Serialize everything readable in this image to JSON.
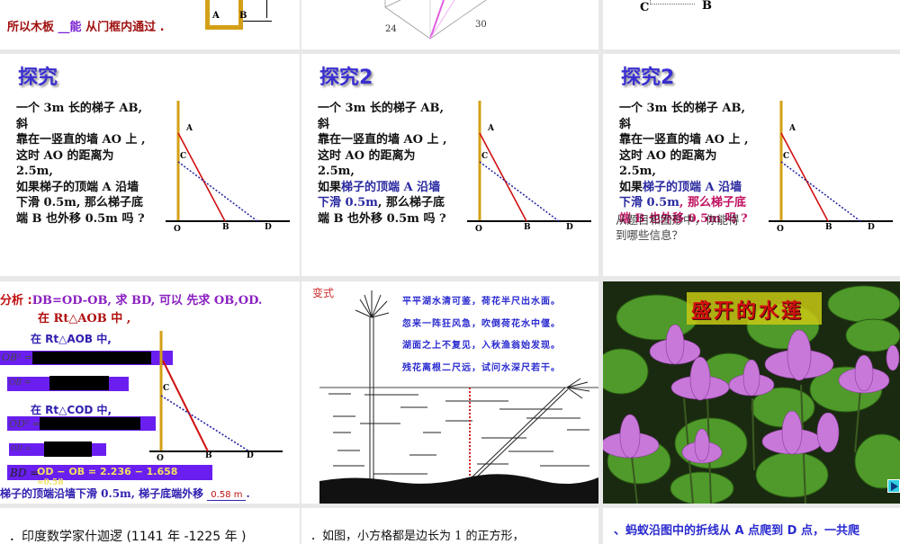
{
  "row1": {
    "slide1": {
      "conclusion_prefix": "所以木板 ",
      "answer": "__能",
      "conclusion_suffix": " 从门框内通过 .",
      "label_a": "A",
      "label_b": "B"
    },
    "slide2": {
      "dim1": "24",
      "dim2": "30"
    },
    "slide3": {
      "label_c": "C",
      "label_b": "B"
    }
  },
  "row2": {
    "slide1": {
      "title": "探究"
    },
    "slide2": {
      "title": "探究2"
    },
    "slide3": {
      "title": "探究2",
      "overlay": "从题目和图形中，你能得到哪些信息？"
    },
    "problem": {
      "l1": "一个 3m 长的梯子 AB, 斜",
      "l2": "靠在一竖直的墙 AO 上 ,",
      "l3": "这时 AO 的距离为 2.5m,",
      "l4a": "如果",
      "l4b": "梯子的顶端 A 沿墙",
      "l5a": "下滑 0.5m",
      "l5b": ", 那么梯子底",
      "l6": "端 B 也外移 0.5m 吗 ?"
    },
    "labels": {
      "a": "A",
      "c": "C",
      "o": "O",
      "b": "B",
      "d": "D"
    }
  },
  "row3": {
    "slide1": {
      "analysis_label": "分析 :",
      "analysis": "DB=OD-OB, 求 BD, 可以  先求 OB,OD.",
      "in_aob": "在 Rt△AOB 中 ,",
      "in_aob2": "在 Rt△AOB 中,",
      "ob2": "OB² =",
      "ob": "OB =",
      "in_cod": "在 Rt△COD 中,",
      "od2": "OD² =",
      "od": "OD =",
      "bd": "BD =",
      "bd_calc": "OD − OB = 2.236  − 1.658",
      "bd_result": "≈0.58",
      "conclusion": "梯子的顶端沿墙下滑 0.5m, 梯子底端外移 ",
      "answer": "0.58 m"
    },
    "slide2": {
      "label": "变式",
      "poem": [
        "平平湖水清可鉴，荷花半尺出水面。",
        "忽来一阵狂风急，吹倒荷花水中偃。",
        "湖面之上不复见，入秋渔翁始发现。",
        "残花离根二尺远，试问水深尺若干。"
      ]
    },
    "slide3": {
      "title": "盛开的水莲",
      "next_icon": "play-next-icon"
    }
  },
  "row4": {
    "slide1": "．印度数学家什迦逻 (1141 年 -1225 年 )",
    "slide2": "．如图，小方格都是边长为 1 的正方形，",
    "slide3": "、蚂蚁沿图中的折线从 A 点爬到 D 点，一共爬"
  }
}
